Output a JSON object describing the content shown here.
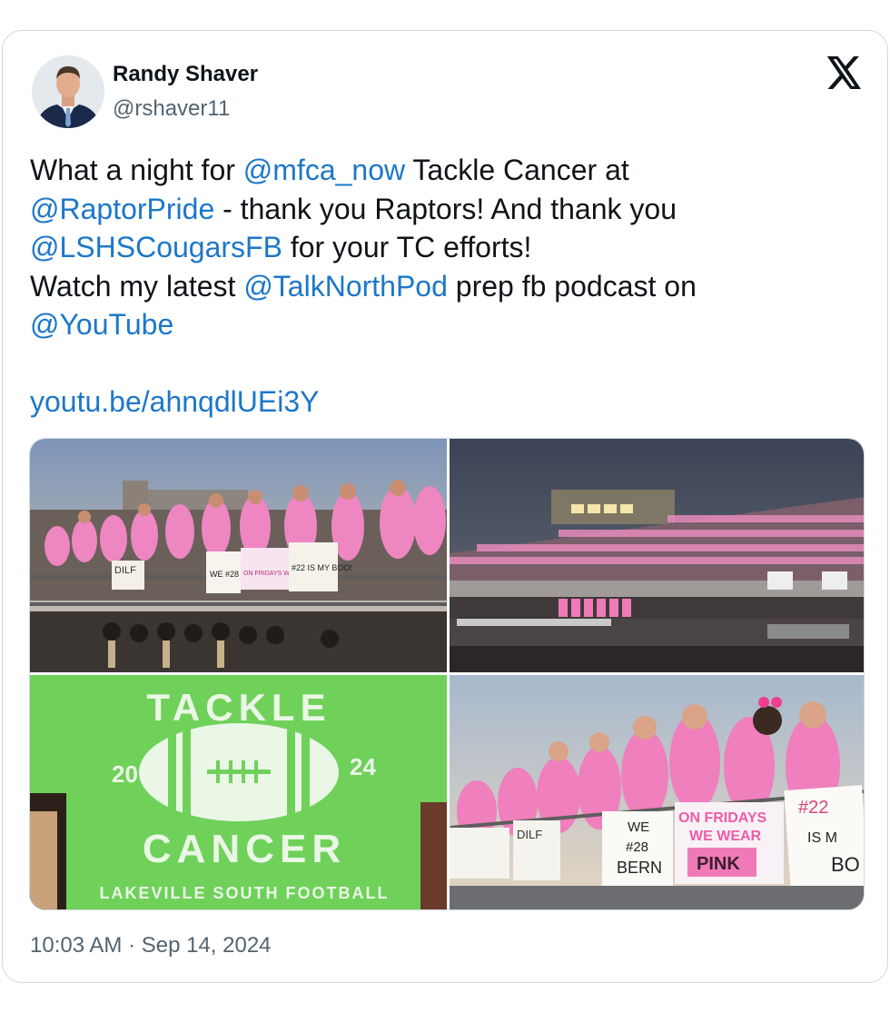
{
  "author": {
    "name": "Randy Shaver",
    "handle": "@rshaver11"
  },
  "tweet": {
    "part1": "What a night for ",
    "mention1": "@mfca_now",
    "part2": " Tackle Cancer at\n",
    "mention2": "@RaptorPride",
    "part3": " - thank you Raptors! And thank you\n",
    "mention3": "@LSHSCougarsFB",
    "part4": " for your TC efforts!\nWatch my latest ",
    "mention4": "@TalkNorthPod",
    "part5": " prep fb podcast on\n",
    "mention5": "@YouTube",
    "part6": "\n\n",
    "link": "youtu.be/ahnqdlUEi3Y"
  },
  "photos": {
    "p1": {
      "sign1": "DILF",
      "sign2": "WE #28 BERN",
      "sign3": "ON FRIDAYS WE WEAR PINK",
      "sign4": "#22 IS MY BOO!"
    },
    "p3": {
      "shirt_top": "TACKLE",
      "year_left": "20",
      "year_right": "24",
      "shirt_bottom": "CANCER",
      "shirt_footer": "LAKEVILLE SOUTH FOOTBALL"
    },
    "p4": {
      "sign1": "DILF",
      "sign2_l1": "WE",
      "sign2_l2": "#28",
      "sign2_l3": "BERN",
      "sign3_l1": "ON FRIDAYS",
      "sign3_l2": "WE WEAR",
      "sign3_l3": "PINK",
      "sign4_l1": "#22",
      "sign4_l2": "IS M",
      "sign4_l3": "BO"
    }
  },
  "timestamp": "10:03 AM · Sep 14, 2024",
  "colors": {
    "link": "#1d77c9",
    "text": "#0f1419",
    "muted": "#536471",
    "shirt_green": "#6fd15a",
    "pink": "#f07ab8"
  },
  "icons": [
    "x-logo-icon",
    "avatar-image"
  ]
}
